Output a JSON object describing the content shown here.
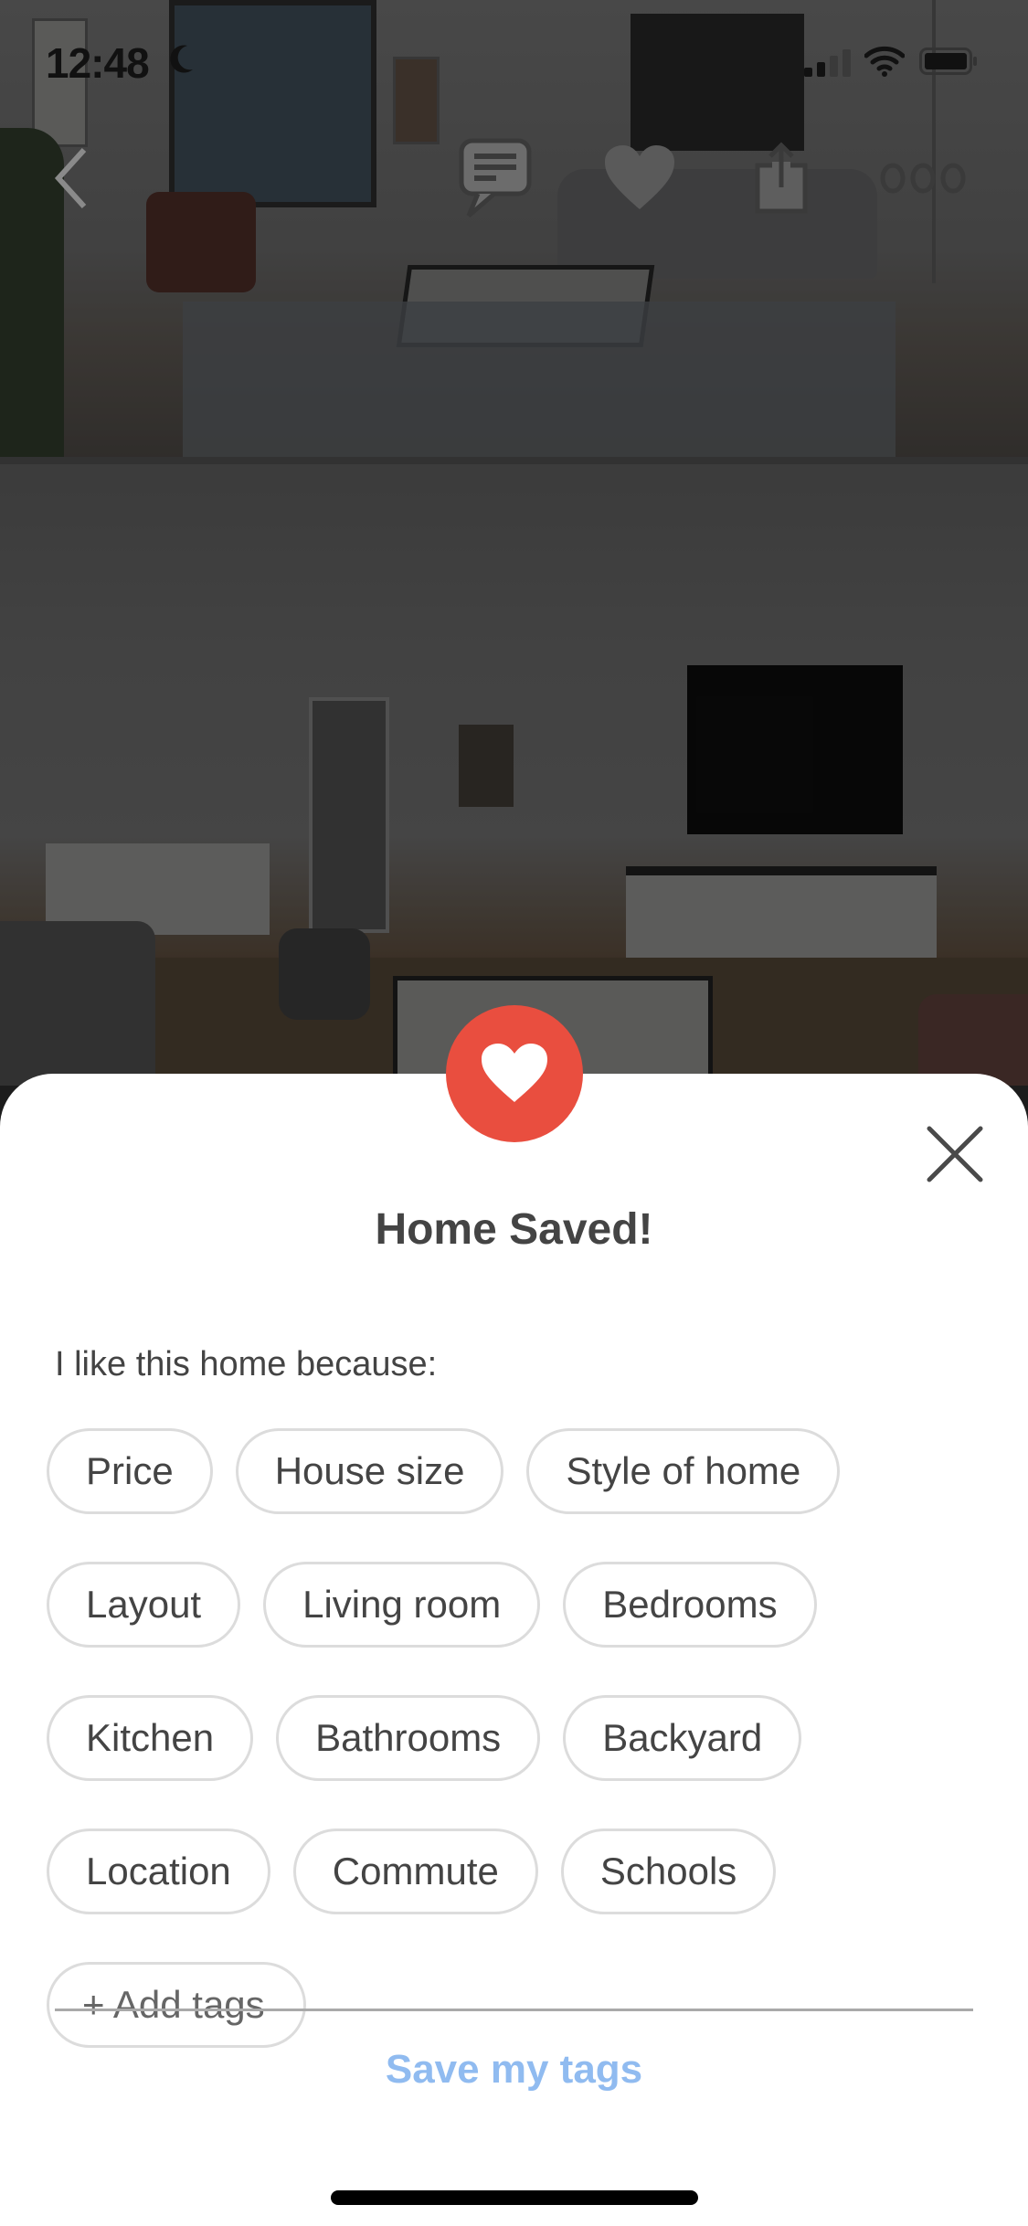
{
  "status_bar": {
    "time": "12:48",
    "do_not_disturb_icon": "moon-icon",
    "signal_icon": "cellular-signal-icon",
    "wifi_icon": "wifi-icon",
    "battery_icon": "battery-icon"
  },
  "nav": {
    "back_icon": "chevron-left-icon",
    "chat_icon": "message-icon",
    "favorite_icon": "heart-icon",
    "share_icon": "share-icon",
    "more_icon": "more-options-icon"
  },
  "listing_photos": [
    {
      "description": "Living room with window, gray sofa and coffee table"
    },
    {
      "description": "Living room with wall-mounted TV, white credenza and hallway"
    }
  ],
  "sheet": {
    "badge_icon": "heart-icon",
    "close_icon": "close-icon",
    "title": "Home Saved!",
    "prompt": "I like this home because:",
    "tag_rows": [
      [
        "Price",
        "House size",
        "Style of home"
      ],
      [
        "Layout",
        "Living room",
        "Bedrooms"
      ],
      [
        "Kitchen",
        "Bathrooms",
        "Backyard"
      ],
      [
        "Location",
        "Commute",
        "Schools"
      ]
    ],
    "add_tags_label": "+ Add tags",
    "save_label": "Save my tags"
  },
  "colors": {
    "accent_red": "#e94e3f",
    "save_link_blue": "#90bbf0",
    "text_dark": "#444444",
    "pill_border": "#dcdcdc"
  }
}
